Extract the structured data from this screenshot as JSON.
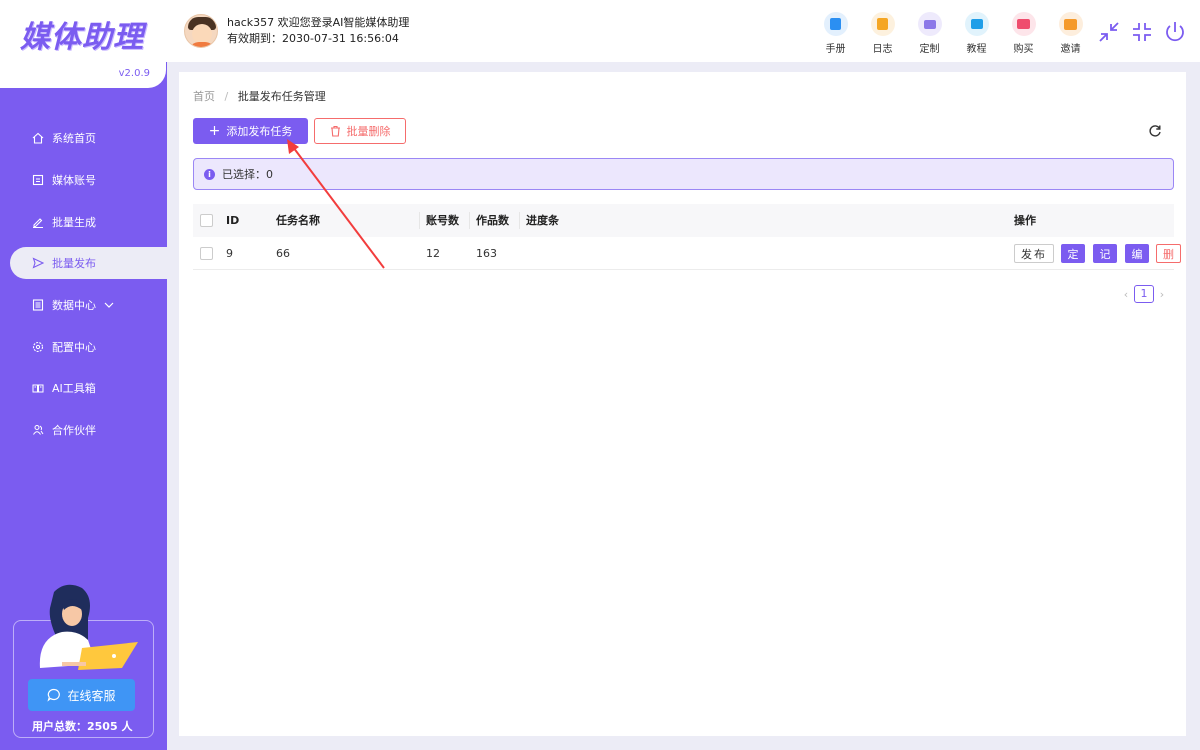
{
  "app": {
    "logo_text": "媒体助理",
    "version": "v2.0.9"
  },
  "header": {
    "greeting": "hack357 欢迎您登录AI智能媒体助理",
    "expiry": "有效期到：2030-07-31 16:56:04",
    "tools": [
      {
        "label": "手册",
        "icon": "manual-icon",
        "color": "#2b8ff2",
        "bg": "#e3f0fd"
      },
      {
        "label": "日志",
        "icon": "log-icon",
        "color": "#f5a623",
        "bg": "#fdf1de"
      },
      {
        "label": "定制",
        "icon": "custom-icon",
        "color": "#8c78e8",
        "bg": "#eeeafc"
      },
      {
        "label": "教程",
        "icon": "tutorial-icon",
        "color": "#1f9ee8",
        "bg": "#e1f3fc"
      },
      {
        "label": "购买",
        "icon": "purchase-icon",
        "color": "#ef4d6e",
        "bg": "#fde5ea"
      },
      {
        "label": "邀请",
        "icon": "invite-icon",
        "color": "#f59a2b",
        "bg": "#fdeedd"
      }
    ]
  },
  "sidebar": {
    "items": [
      {
        "label": "系统首页",
        "icon": "home-icon"
      },
      {
        "label": "媒体账号",
        "icon": "account-icon"
      },
      {
        "label": "批量生成",
        "icon": "edit-icon"
      },
      {
        "label": "批量发布",
        "icon": "send-icon",
        "active": true
      },
      {
        "label": "数据中心",
        "icon": "data-icon",
        "expandable": true
      },
      {
        "label": "配置中心",
        "icon": "settings-icon"
      },
      {
        "label": "AI工具箱",
        "icon": "toolbox-icon"
      },
      {
        "label": "合作伙伴",
        "icon": "partner-icon"
      }
    ],
    "support_label": "在线客服",
    "user_total": "用户总数：2505 人"
  },
  "breadcrumb": {
    "home": "首页",
    "separator": "/",
    "current": "批量发布任务管理"
  },
  "toolbar": {
    "add_label": "添加发布任务",
    "delete_label": "批量删除"
  },
  "selection": {
    "text": "已选择：0"
  },
  "table": {
    "columns": {
      "id": "ID",
      "name": "任务名称",
      "accounts": "账号数",
      "works": "作品数",
      "progress": "进度条",
      "ops": "操作"
    },
    "rows": [
      {
        "id": "9",
        "name": "66",
        "accounts": "12",
        "works": "163",
        "progress": ""
      }
    ],
    "row_actions": {
      "publish": "发布",
      "schedule": "定",
      "record": "记",
      "edit": "编",
      "delete": "删"
    }
  },
  "pagination": {
    "current_page": "1"
  },
  "colors": {
    "accent": "#7b5cf0",
    "danger": "#f56c6c",
    "support": "#3f95f5",
    "annotation_arrow": "#f23d3d"
  }
}
